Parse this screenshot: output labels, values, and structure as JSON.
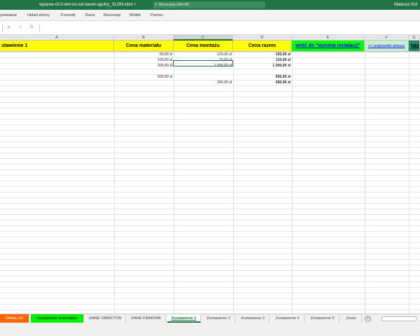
{
  "titlebar": {
    "document": "wycena-v3.0-wm-nn-sst-wezel-ogolny_XLSM.xlsm  •",
    "search_placeholder": "Wyszukaj (Alt+M)",
    "user": "Mateusz Kol"
  },
  "ribbon": {
    "tabs": [
      "ysowanie",
      "Układ strony",
      "Formuły",
      "Dane",
      "Recenzja",
      "Widok",
      "Pomoc"
    ]
  },
  "formula_bar": {
    "cancel": "✕",
    "enter": "✓",
    "fx": "fx",
    "value": ""
  },
  "columns": [
    "A",
    "B",
    "C",
    "D",
    "E",
    "F",
    "G"
  ],
  "header_row": {
    "a": "stawienie 1",
    "b": "Cena materiału",
    "c": "Cena montażu",
    "d": "Cena razem",
    "e": "wróć do \"wycena instalacji\"",
    "f": "<< poprzedni arkusz",
    "g": "nas"
  },
  "rows": [
    {
      "b": "50,00 zł",
      "c": "120,00 zł",
      "d": "150,00 zł"
    },
    {
      "b": "100,00 zł",
      "c": "10,00 zł",
      "d": "110,00 zł"
    },
    {
      "b": "200,00 zł",
      "c": "1 000,00 zł",
      "d": "1 200,00 zł"
    },
    {
      "b": "",
      "c": "",
      "d": ""
    },
    {
      "b": "500,00 zł",
      "c": "",
      "d": "500,00 zł"
    },
    {
      "b": "",
      "c": "200,00 zł",
      "d": "200,00 zł"
    }
  ],
  "sheet_tabs": [
    "Oferta,+M",
    "Zestawienie materiałów",
    "DANE OBIEKTÓW",
    "DANE FIRMOWE",
    "Zestawienie 1",
    "Zestawienie 2",
    "Zestawienie 3",
    "Zestawienie 4",
    "Zestawienie 5",
    "Zesta"
  ],
  "active_tab": "Zestawienie 1",
  "add_sheet": "+",
  "colors": {
    "excel_green": "#217346",
    "header_yellow": "#ffff00",
    "link_green": "#00ff00",
    "tab_orange": "#ff6600"
  }
}
